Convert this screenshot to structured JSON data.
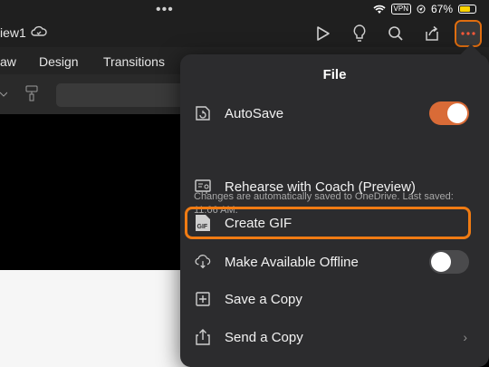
{
  "status": {
    "vpn": "VPN",
    "battery": "67%",
    "battery_level": 0.67
  },
  "titlebar": {
    "doc_title": "iew1"
  },
  "ribbon": {
    "tabs": [
      "aw",
      "Design",
      "Transitions"
    ]
  },
  "file_menu": {
    "title": "File",
    "autosave_label": "AutoSave",
    "autosave_on": true,
    "autosave_note": "Changes are automatically saved to OneDrive. Last saved: 11:06 AM.",
    "items": [
      {
        "label": "Rehearse with Coach (Preview)"
      },
      {
        "label": "Create GIF",
        "icon_text": "GIF"
      },
      {
        "label": "Make Available Offline"
      },
      {
        "label": "Save a Copy"
      },
      {
        "label": "Send a Copy"
      }
    ],
    "offline_on": false
  },
  "colors": {
    "accent": "#f07b13",
    "toggle_on": "#d96b37"
  }
}
